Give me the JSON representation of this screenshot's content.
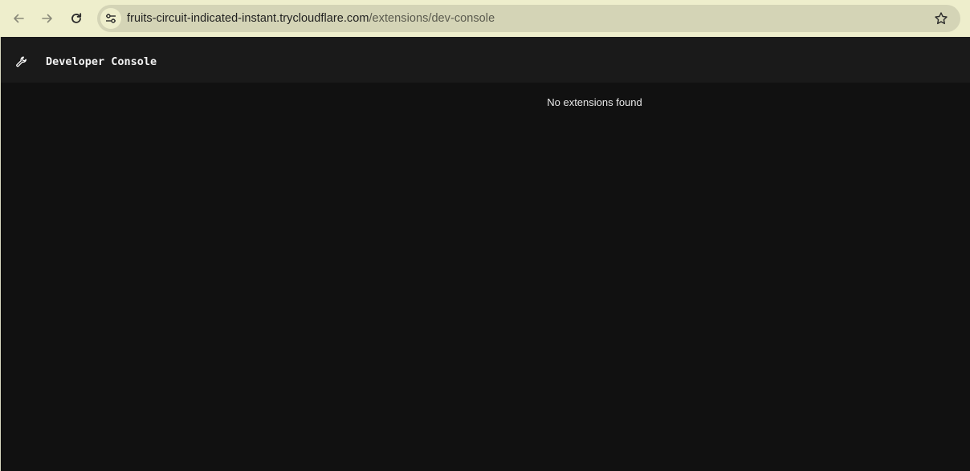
{
  "browser": {
    "url_host": "fruits-circuit-indicated-instant.trycloudflare.com",
    "url_path": "/extensions/dev-console"
  },
  "header": {
    "icon": "wrench-icon",
    "title": "Developer Console"
  },
  "content": {
    "empty_message": "No extensions found"
  },
  "colors": {
    "chrome_background": "#eeeecc",
    "omnibox_background": "#d4d4b6",
    "page_background": "#111111",
    "header_background": "#1a1a1a"
  }
}
